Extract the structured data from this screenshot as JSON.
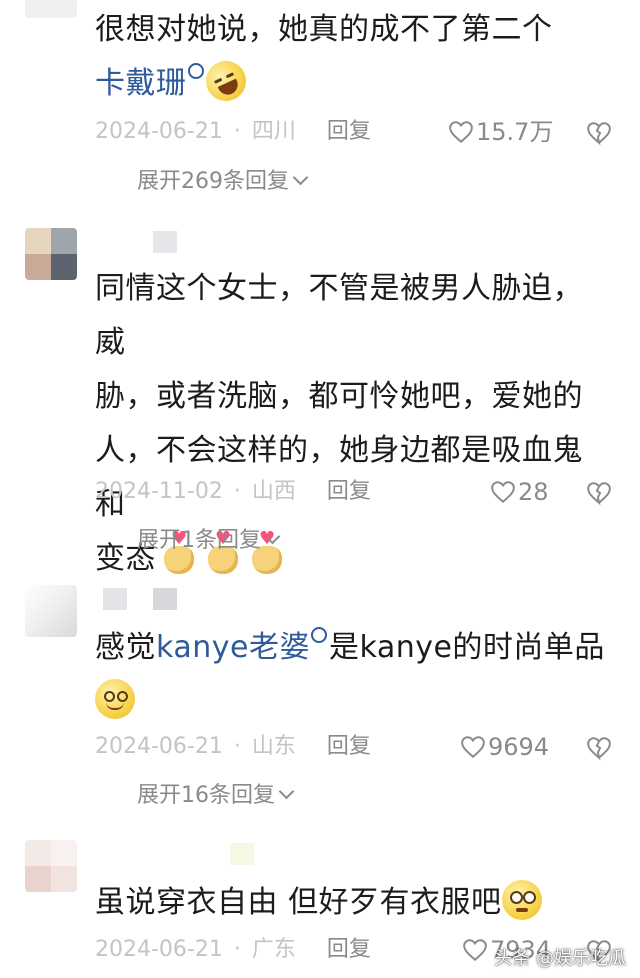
{
  "comments": [
    {
      "text_lines": [
        "很想对她说，她真的成不了第二个"
      ],
      "link_text": "卡戴珊",
      "emoji": "rolling-laugh-emoji",
      "date": "2024-06-21",
      "location": "四川",
      "reply_label": "回复",
      "likes": "15.7万",
      "expand_label": "展开269条回复"
    },
    {
      "text_lines": [
        "同情这个女士，不管是被男人胁迫，威",
        "胁，或者洗脑，都可怜她吧，爱她的",
        "人，不会这样的，她身边都是吸血鬼和",
        "变态"
      ],
      "emoji": "heart-hands-emoji",
      "date": "2024-11-02",
      "location": "山西",
      "reply_label": "回复",
      "likes": "28",
      "expand_label": "展开1条回复"
    },
    {
      "prefix": "感觉",
      "link_text": "kanye老婆",
      "suffix": "是kanye的时尚单品",
      "emoji": "dizzy-smile-emoji",
      "date": "2024-06-21",
      "location": "山东",
      "reply_label": "回复",
      "likes": "9694",
      "expand_label": "展开16条回复"
    },
    {
      "text": "虽说穿衣自由 但好歹有衣服吧",
      "emoji": "pleading-emoji",
      "date": "2024-06-21",
      "location": "广东",
      "reply_label": "回复",
      "likes": "7934"
    }
  ],
  "separator": "·",
  "watermark": "头条 @娱乐吃瓜",
  "colors": {
    "link": "#2f5a9b",
    "meta": "#c4c4c4",
    "reply": "#8a8a8a",
    "text": "#1c1c1c"
  }
}
